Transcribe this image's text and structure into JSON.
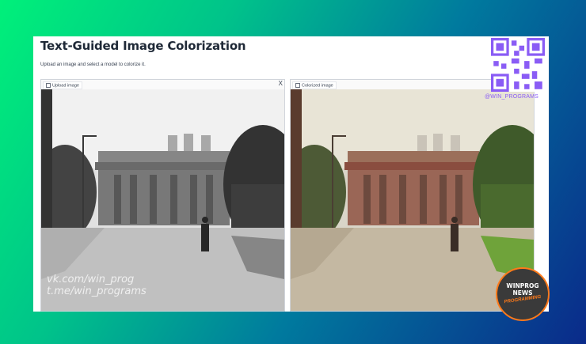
{
  "app": {
    "title": "Text-Guided Image Colorization",
    "subtitle": "Upload an image and select a model to colorize it."
  },
  "upload_panel": {
    "label": "Upload image",
    "close_label": "X"
  },
  "output_panel": {
    "label": "Colorized image"
  },
  "watermark": {
    "line1": "vk.com/win_prog",
    "line2": "t.me/win_programs"
  },
  "qr": {
    "handle": "@WIN_PROGRAMS"
  },
  "badge": {
    "line1": "WINPROG",
    "line2": "NEWS",
    "line3": "PROGRAMMING"
  },
  "colors": {
    "background_start": "#00f07a",
    "background_end": "#0a2a8a",
    "badge_accent": "#ff7a1a",
    "qr_accent": "#8a5cf5"
  }
}
